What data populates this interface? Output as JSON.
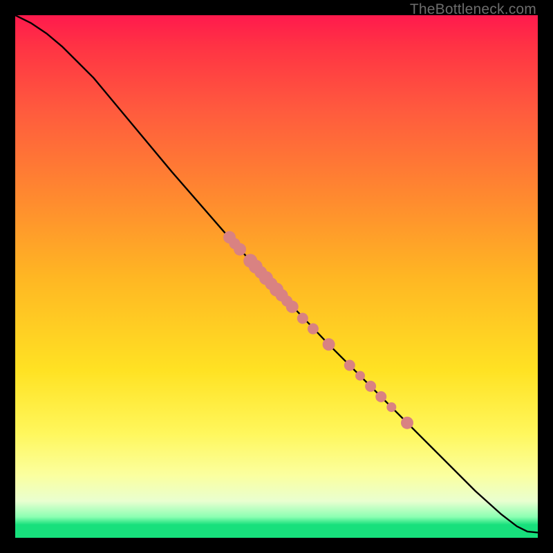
{
  "watermark": "TheBottleneck.com",
  "colors": {
    "marker": "#d98282",
    "line": "#000000",
    "frame_bg": "#000000"
  },
  "chart_data": {
    "type": "line",
    "title": "",
    "xlabel": "",
    "ylabel": "",
    "xlim": [
      0,
      100
    ],
    "ylim": [
      0,
      100
    ],
    "grid": false,
    "legend": false,
    "series": [
      {
        "name": "curve",
        "kind": "line",
        "x": [
          0,
          3,
          6,
          9,
          12,
          15,
          20,
          30,
          40,
          50,
          60,
          70,
          80,
          88,
          93,
          96,
          98,
          100
        ],
        "y": [
          100,
          98.5,
          96.5,
          94,
          91,
          88,
          82,
          70,
          58.5,
          47.5,
          37,
          27,
          17,
          9,
          4.5,
          2.2,
          1.2,
          1.0
        ]
      },
      {
        "name": "cluster-points",
        "kind": "scatter",
        "x": [
          41,
          42,
          43,
          45,
          46,
          47,
          48,
          49,
          50,
          51,
          52,
          53,
          55,
          57,
          60,
          64,
          66,
          68,
          70,
          72,
          75
        ],
        "y": [
          57.5,
          56.3,
          55.2,
          53.0,
          51.9,
          50.8,
          49.7,
          48.6,
          47.5,
          46.4,
          45.3,
          44.2,
          42.0,
          40.0,
          37.0,
          33.0,
          31.0,
          29.0,
          27.0,
          25.0,
          22.0
        ],
        "size": [
          9,
          8,
          9,
          10,
          10,
          9,
          10,
          9,
          10,
          9,
          8,
          9,
          8,
          8,
          9,
          8,
          7,
          8,
          8,
          7,
          9
        ]
      }
    ]
  }
}
